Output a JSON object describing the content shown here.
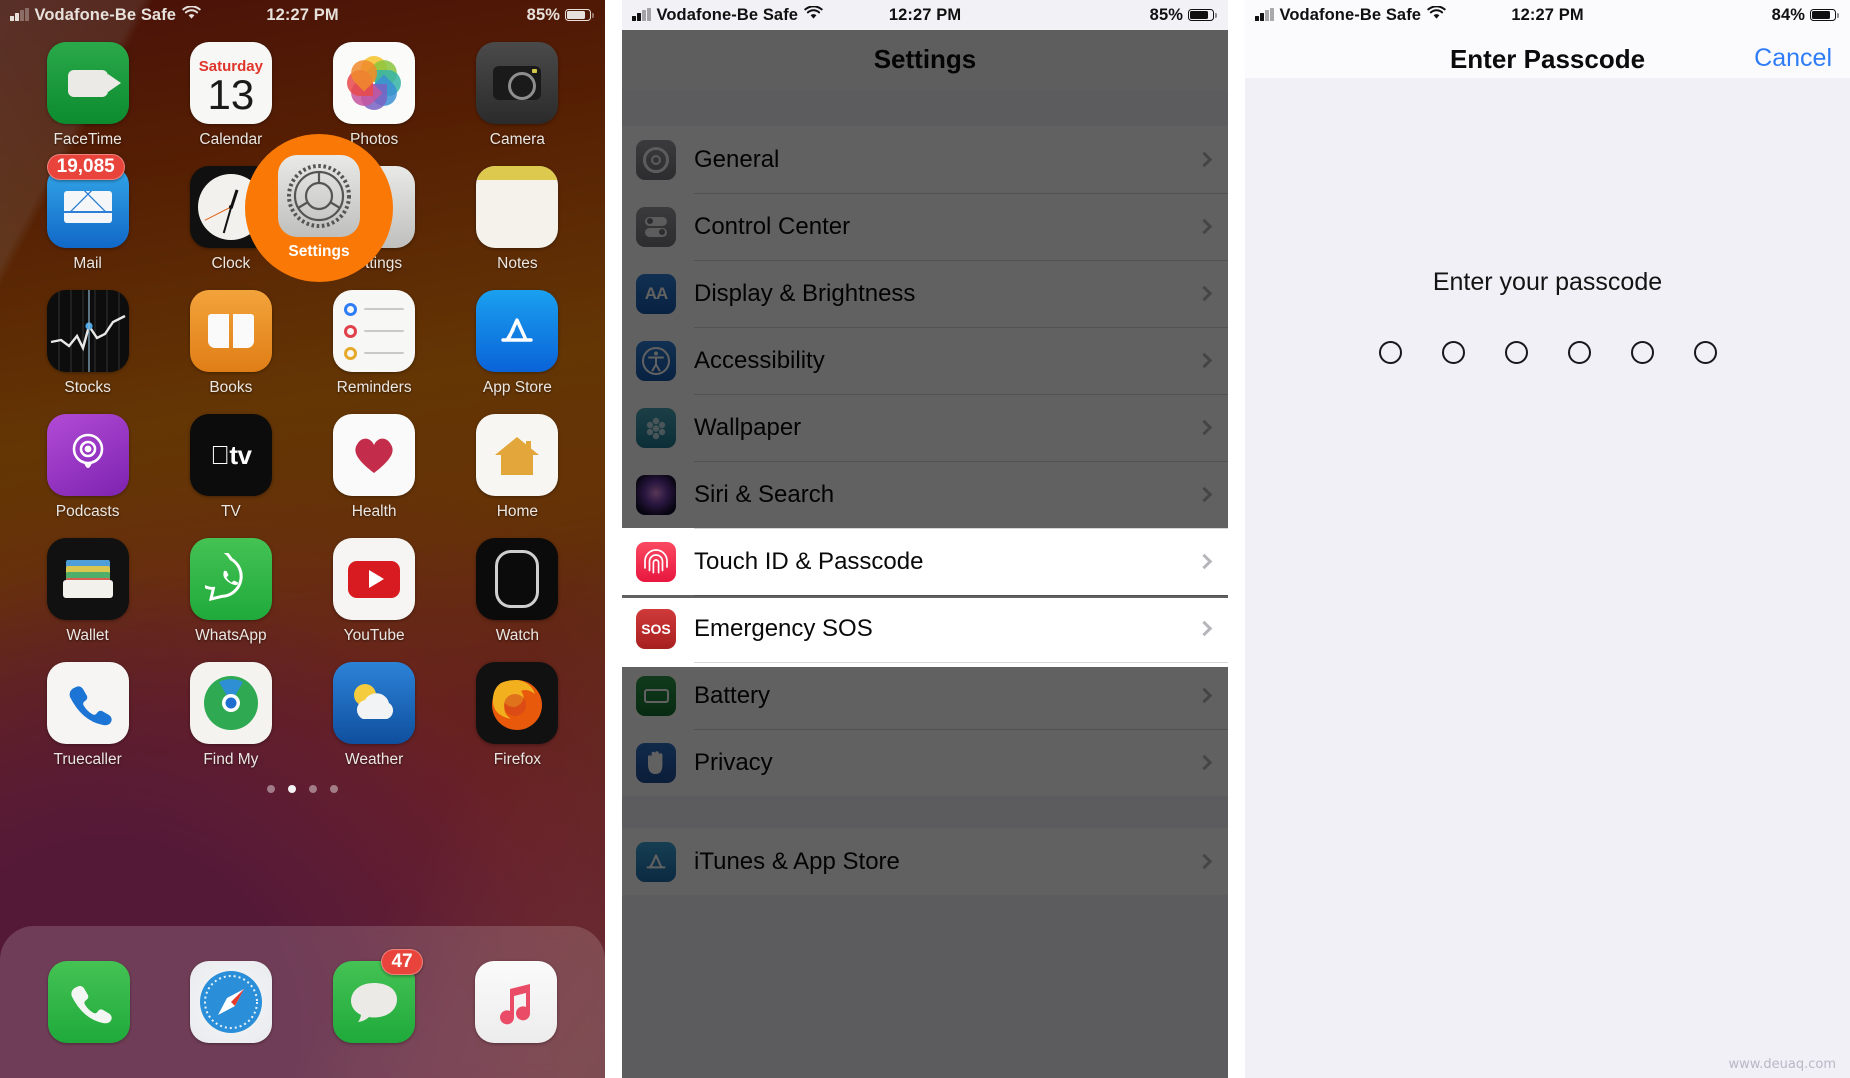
{
  "watermark": "www.deuaq.com",
  "colors": {
    "highlight": "#f97806",
    "accent_blue": "#2f7df6",
    "touchid_red": "#fb4a62"
  },
  "panel_home": {
    "status": {
      "carrier": "Vodafone-Be Safe",
      "time": "12:27 PM",
      "battery": "85%"
    },
    "apps": [
      {
        "label": "FaceTime",
        "icon": "facetime-icon"
      },
      {
        "label": "Calendar",
        "icon": "calendar-icon",
        "day": "Saturday",
        "date": "13"
      },
      {
        "label": "Photos",
        "icon": "photos-icon"
      },
      {
        "label": "Camera",
        "icon": "camera-icon"
      },
      {
        "label": "Mail",
        "icon": "mail-icon",
        "badge": "19,085"
      },
      {
        "label": "Clock",
        "icon": "clock-icon"
      },
      {
        "label": "Settings",
        "icon": "settings-icon"
      },
      {
        "label": "Notes",
        "icon": "notes-icon"
      },
      {
        "label": "Stocks",
        "icon": "stocks-icon"
      },
      {
        "label": "Books",
        "icon": "books-icon"
      },
      {
        "label": "Reminders",
        "icon": "reminders-icon"
      },
      {
        "label": "App Store",
        "icon": "app-store-icon"
      },
      {
        "label": "Podcasts",
        "icon": "podcasts-icon"
      },
      {
        "label": "TV",
        "icon": "tv-icon"
      },
      {
        "label": "Health",
        "icon": "health-icon"
      },
      {
        "label": "Home",
        "icon": "home-icon"
      },
      {
        "label": "Wallet",
        "icon": "wallet-icon"
      },
      {
        "label": "WhatsApp",
        "icon": "whatsapp-icon"
      },
      {
        "label": "YouTube",
        "icon": "youtube-icon"
      },
      {
        "label": "Watch",
        "icon": "watch-icon"
      },
      {
        "label": "Truecaller",
        "icon": "truecaller-icon"
      },
      {
        "label": "Find My",
        "icon": "find-my-icon"
      },
      {
        "label": "Weather",
        "icon": "weather-icon"
      },
      {
        "label": "Firefox",
        "icon": "firefox-icon"
      }
    ],
    "page_dots": {
      "count": 4,
      "active_index": 1
    },
    "dock": [
      {
        "label": "Phone",
        "icon": "phone-icon"
      },
      {
        "label": "Safari",
        "icon": "safari-icon"
      },
      {
        "label": "Messages",
        "icon": "messages-icon",
        "badge": "47"
      },
      {
        "label": "Music",
        "icon": "music-icon"
      }
    ],
    "spotlight": {
      "label": "Settings",
      "icon": "settings-icon"
    }
  },
  "panel_settings": {
    "status": {
      "carrier": "Vodafone-Be Safe",
      "time": "12:27 PM",
      "battery": "85%"
    },
    "title": "Settings",
    "group1": [
      {
        "label": "General",
        "icon": "gear-icon"
      },
      {
        "label": "Control Center",
        "icon": "control-center-icon"
      },
      {
        "label": "Display & Brightness",
        "icon": "display-brightness-icon"
      },
      {
        "label": "Accessibility",
        "icon": "accessibility-icon"
      },
      {
        "label": "Wallpaper",
        "icon": "wallpaper-icon"
      },
      {
        "label": "Siri & Search",
        "icon": "siri-icon"
      },
      {
        "label": "Touch ID & Passcode",
        "icon": "fingerprint-icon"
      },
      {
        "label": "Emergency SOS",
        "icon": "sos-icon"
      },
      {
        "label": "Battery",
        "icon": "battery-icon"
      },
      {
        "label": "Privacy",
        "icon": "privacy-hand-icon"
      }
    ],
    "group2": [
      {
        "label": "iTunes & App Store",
        "icon": "app-store-icon"
      }
    ],
    "highlighted_row": "Touch ID & Passcode"
  },
  "panel_passcode": {
    "status": {
      "carrier": "Vodafone-Be Safe",
      "time": "12:27 PM",
      "battery": "84%"
    },
    "title": "Enter Passcode",
    "cancel_label": "Cancel",
    "prompt": "Enter your passcode",
    "dot_count": 6,
    "filled_count": 0
  }
}
